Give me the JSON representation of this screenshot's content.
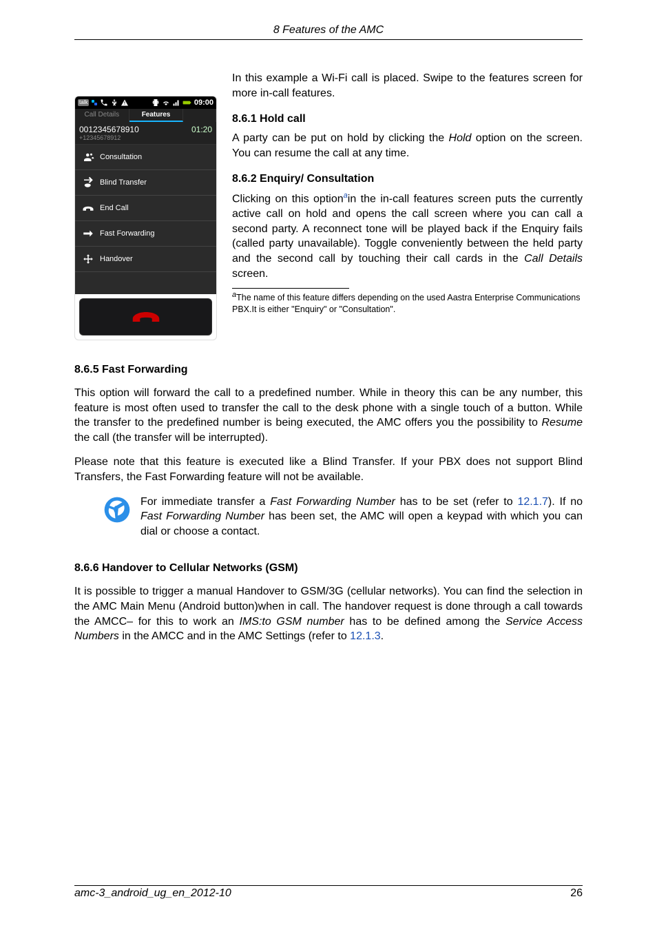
{
  "running_header": "8  Features of the AMC",
  "phone": {
    "statusbar_time": "09:00",
    "tab_details": "Call Details",
    "tab_features": "Features",
    "call_number": "0012345678910",
    "call_sub": "+12345678912",
    "call_elapsed": "01:20",
    "features": {
      "consultation": "Consultation",
      "blind_transfer": "Blind Transfer",
      "end_call": "End Call",
      "fast_forwarding": "Fast Forwarding",
      "handover": "Handover"
    }
  },
  "intro": "In this example a Wi-Fi call is placed. Swipe to the features screen for more in-call features.",
  "s861_title": "8.6.1   Hold call",
  "s861_body": "A party can be put on hold by clicking the Hold option on the screen. You can resume the call at any time.",
  "s862_title": "8.6.2   Enquiry/ Consultation",
  "s862_body_pre": "Clicking on this option",
  "s862_fn_ref": "a",
  "s862_body_post": "in the in-call features screen puts the currently active call on hold and opens the call screen where you can call a second party. A reconnect tone will be played back if the Enquiry fails (called party unavailable). Toggle conveniently between the held party and the second call by touching their call cards in the Call Details screen.",
  "fn_mark": "a",
  "fn_text": "The name of this feature differs depending on the used Aastra Enterprise Communications PBX.It is either \"Enquiry\" or \"Consultation\".",
  "s865_title": "8.6.5   Fast Forwarding",
  "s865_p1": "This option will forward the call to a predefined number. While in theory this can be any number, this feature is most often used to transfer the call to the desk phone with a single touch of a button. While the transfer to the predefined number is being executed, the AMC offers you the possibility to Resume the call (the transfer will be interrupted).",
  "s865_p2": "Please note that this feature is executed like a Blind Transfer. If your PBX does not support Blind Transfers, the Fast Forwarding feature will not be available.",
  "note_pre": "For immediate transfer a Fast Forwarding Number has to be set (refer to ",
  "note_link": "12.1.7",
  "note_post": "). If no Fast Forwarding Number has been set, the AMC will open a keypad with which you can dial or choose a contact.",
  "s866_title": "8.6.6   Handover to Cellular Networks (GSM)",
  "s866_body_pre": "It is possible to trigger a manual Handover to GSM/3G (cellular networks). You can find the selection in the AMC Main Menu (Android button)when in call. The handover request is done through a call towards the AMCC– for this to work an IMS:to GSM number has to be defined among the Service Access Numbers in the AMCC and in the AMC Settings (refer to ",
  "s866_link": "12.1.3",
  "s866_body_post": ".",
  "footer_left": "amc-3_android_ug_en_2012-10",
  "footer_right": "26"
}
